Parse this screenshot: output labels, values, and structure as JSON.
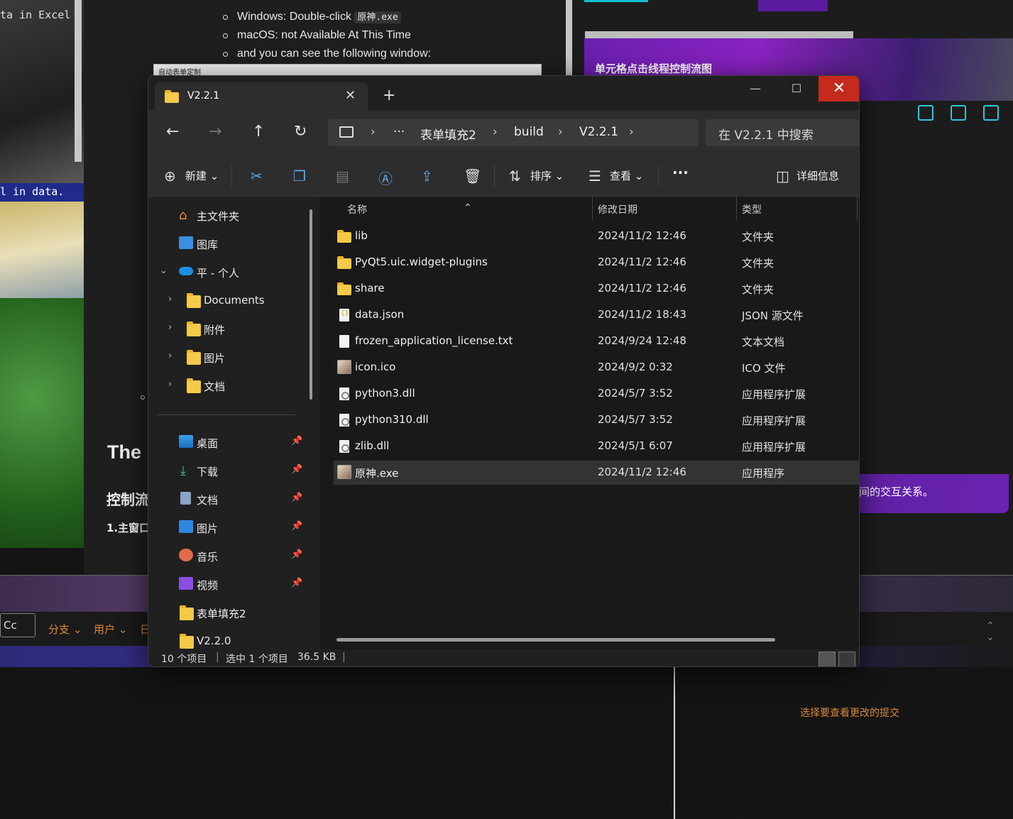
{
  "background": {
    "left_code_1": "ta in Excel",
    "left_code_2": "l in data.",
    "doc_items": [
      "Windows: Double-click",
      "macOS: not Available At This Time",
      "and you can see the following window:"
    ],
    "doc_code": "原神.exe",
    "doc_thumb_title": "自动表单定制",
    "doc_the": "The",
    "doc_h2": "控制流",
    "doc_h3": "1.主窗口",
    "right_banner": "单元格点击线程控制流图",
    "right_banner2": "间的交互关系。",
    "toolbar_cc": "Cc",
    "toolbar_branch": "分支",
    "toolbar_user": "用户",
    "toolbar_date": "日",
    "bottom_message": "选择要查看更改的提交"
  },
  "window": {
    "tab_title": "V2.2.1",
    "close_tab": "✕",
    "new_tab": "+",
    "minimize": "—",
    "maximize": "☐",
    "close": "✕"
  },
  "nav": {
    "back": "←",
    "forward": "→",
    "up": "↑",
    "refresh": "↻",
    "breadcrumb": [
      "表单填充2",
      "build",
      "V2.2.1"
    ],
    "ellipsis": "···",
    "search_placeholder": "在 V2.2.1 中搜索"
  },
  "commands": {
    "new": "新建",
    "sort": "排序",
    "view": "查看",
    "more": "···",
    "details": "详细信息"
  },
  "sidebar": {
    "items": [
      {
        "label": "主文件夹"
      },
      {
        "label": "图库"
      },
      {
        "label": "平 - 个人"
      },
      {
        "label": "Documents"
      },
      {
        "label": "附件"
      },
      {
        "label": "图片"
      },
      {
        "label": "文档"
      },
      {
        "label": "桌面"
      },
      {
        "label": "下载"
      },
      {
        "label": "文档"
      },
      {
        "label": "图片"
      },
      {
        "label": "音乐"
      },
      {
        "label": "视频"
      },
      {
        "label": "表单填充2"
      },
      {
        "label": "V2.2.0"
      }
    ]
  },
  "columns": {
    "name": "名称",
    "date": "修改日期",
    "type": "类型"
  },
  "files": [
    {
      "name": "lib",
      "date": "2024/11/2 12:46",
      "type": "文件夹",
      "icon": "folder-icon"
    },
    {
      "name": "PyQt5.uic.widget-plugins",
      "date": "2024/11/2 12:46",
      "type": "文件夹",
      "icon": "folder-icon"
    },
    {
      "name": "share",
      "date": "2024/11/2 12:46",
      "type": "文件夹",
      "icon": "folder-icon"
    },
    {
      "name": "data.json",
      "date": "2024/11/2 18:43",
      "type": "JSON 源文件",
      "icon": "json-file-icon"
    },
    {
      "name": "frozen_application_license.txt",
      "date": "2024/9/24 12:48",
      "type": "文本文档",
      "icon": "text-file-icon"
    },
    {
      "name": "icon.ico",
      "date": "2024/9/2 0:32",
      "type": "ICO 文件",
      "icon": "image-file-icon"
    },
    {
      "name": "python3.dll",
      "date": "2024/5/7 3:52",
      "type": "应用程序扩展",
      "icon": "dll-file-icon"
    },
    {
      "name": "python310.dll",
      "date": "2024/5/7 3:52",
      "type": "应用程序扩展",
      "icon": "dll-file-icon"
    },
    {
      "name": "zlib.dll",
      "date": "2024/5/1 6:07",
      "type": "应用程序扩展",
      "icon": "dll-file-icon"
    },
    {
      "name": "原神.exe",
      "date": "2024/11/2 12:46",
      "type": "应用程序",
      "icon": "exe-file-icon"
    }
  ],
  "status": {
    "count": "10 个项目",
    "selection": "选中 1 个项目",
    "size": "36.5 KB"
  }
}
